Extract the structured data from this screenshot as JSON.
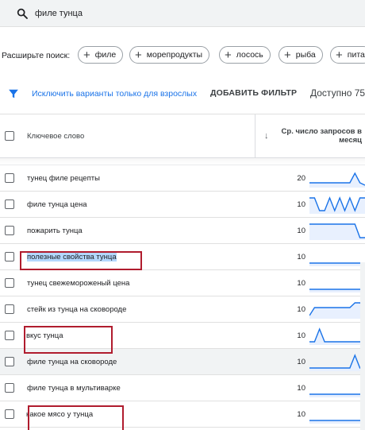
{
  "search": {
    "query": "филе тунца"
  },
  "expand": {
    "label": "Расширьте поиск:",
    "chips": [
      "филе",
      "морепродукты",
      "лосось",
      "рыба",
      "пита"
    ]
  },
  "filters": {
    "adult_exclude": "Исключить варианты только для взрослых",
    "add_filter": "ДОБАВИТЬ ФИЛЬТР",
    "available": "Доступно 75"
  },
  "table": {
    "col_keyword": "Ключевое слово",
    "col_volume": "Ср. число запросов в месяц",
    "rows": [
      {
        "keyword": "тунец филе рецепты",
        "volume": "20",
        "trend": [
          0.2,
          0.2,
          0.2,
          0.2,
          0.2,
          0.2,
          0.2,
          0.2,
          0.2,
          0.8,
          0.2,
          0.05
        ],
        "highlighted": false
      },
      {
        "keyword": "филе тунца цена",
        "volume": "10",
        "trend": [
          0.9,
          0.9,
          0.1,
          0.1,
          0.9,
          0.1,
          0.9,
          0.1,
          0.9,
          0.1,
          0.9,
          0.9
        ],
        "highlighted": false
      },
      {
        "keyword": "пожарить тунца",
        "volume": "10",
        "trend": [
          0.9,
          0.9,
          0.9,
          0.9,
          0.9,
          0.9,
          0.9,
          0.9,
          0.9,
          0.9,
          0.05,
          0.05
        ],
        "highlighted": false
      },
      {
        "keyword": "полезные свойства тунца",
        "volume": "10",
        "trend": [
          0.1,
          0.1,
          0.1,
          0.1,
          0.1,
          0.1,
          0.1,
          0.1,
          0.1,
          0.1,
          0.1,
          0.1
        ],
        "highlighted": true
      },
      {
        "keyword": "тунец свежемороженый цена",
        "volume": "10",
        "trend": [
          0.1,
          0.1,
          0.1,
          0.1,
          0.1,
          0.1,
          0.1,
          0.1,
          0.1,
          0.1,
          0.1,
          0.1
        ],
        "highlighted": false
      },
      {
        "keyword": "стейк из тунца на сковороде",
        "volume": "10",
        "trend": [
          0.1,
          0.6,
          0.6,
          0.6,
          0.6,
          0.6,
          0.6,
          0.6,
          0.6,
          0.9,
          0.9,
          0.6
        ],
        "highlighted": false
      },
      {
        "keyword": "вкус тунца",
        "volume": "10",
        "trend": [
          0.1,
          0.1,
          0.9,
          0.1,
          0.1,
          0.1,
          0.1,
          0.1,
          0.1,
          0.1,
          0.1,
          0.1
        ],
        "highlighted": false
      },
      {
        "keyword": "филе тунца на сковороде",
        "volume": "10",
        "trend": [
          0.1,
          0.1,
          0.1,
          0.1,
          0.1,
          0.1,
          0.1,
          0.1,
          0.1,
          0.9,
          0.1,
          0.1
        ],
        "highlighted": false
      },
      {
        "keyword": "филе тунца в мультиварке",
        "volume": "10",
        "trend": [
          0.1,
          0.1,
          0.1,
          0.1,
          0.1,
          0.1,
          0.1,
          0.1,
          0.1,
          0.1,
          0.1,
          0.1
        ],
        "highlighted": false
      },
      {
        "keyword": "какое мясо у тунца",
        "volume": "10",
        "trend": [
          0.1,
          0.1,
          0.1,
          0.1,
          0.1,
          0.1,
          0.1,
          0.1,
          0.1,
          0.1,
          0.1,
          0.1
        ],
        "highlighted": false
      }
    ]
  },
  "colors": {
    "accent": "#1a73e8",
    "annotation": "#b01c2e",
    "selection": "#b3d7fe"
  },
  "icons": {
    "search": "search-icon",
    "filter": "filter-icon",
    "sort": "arrow-down-icon",
    "add": "plus-icon"
  }
}
